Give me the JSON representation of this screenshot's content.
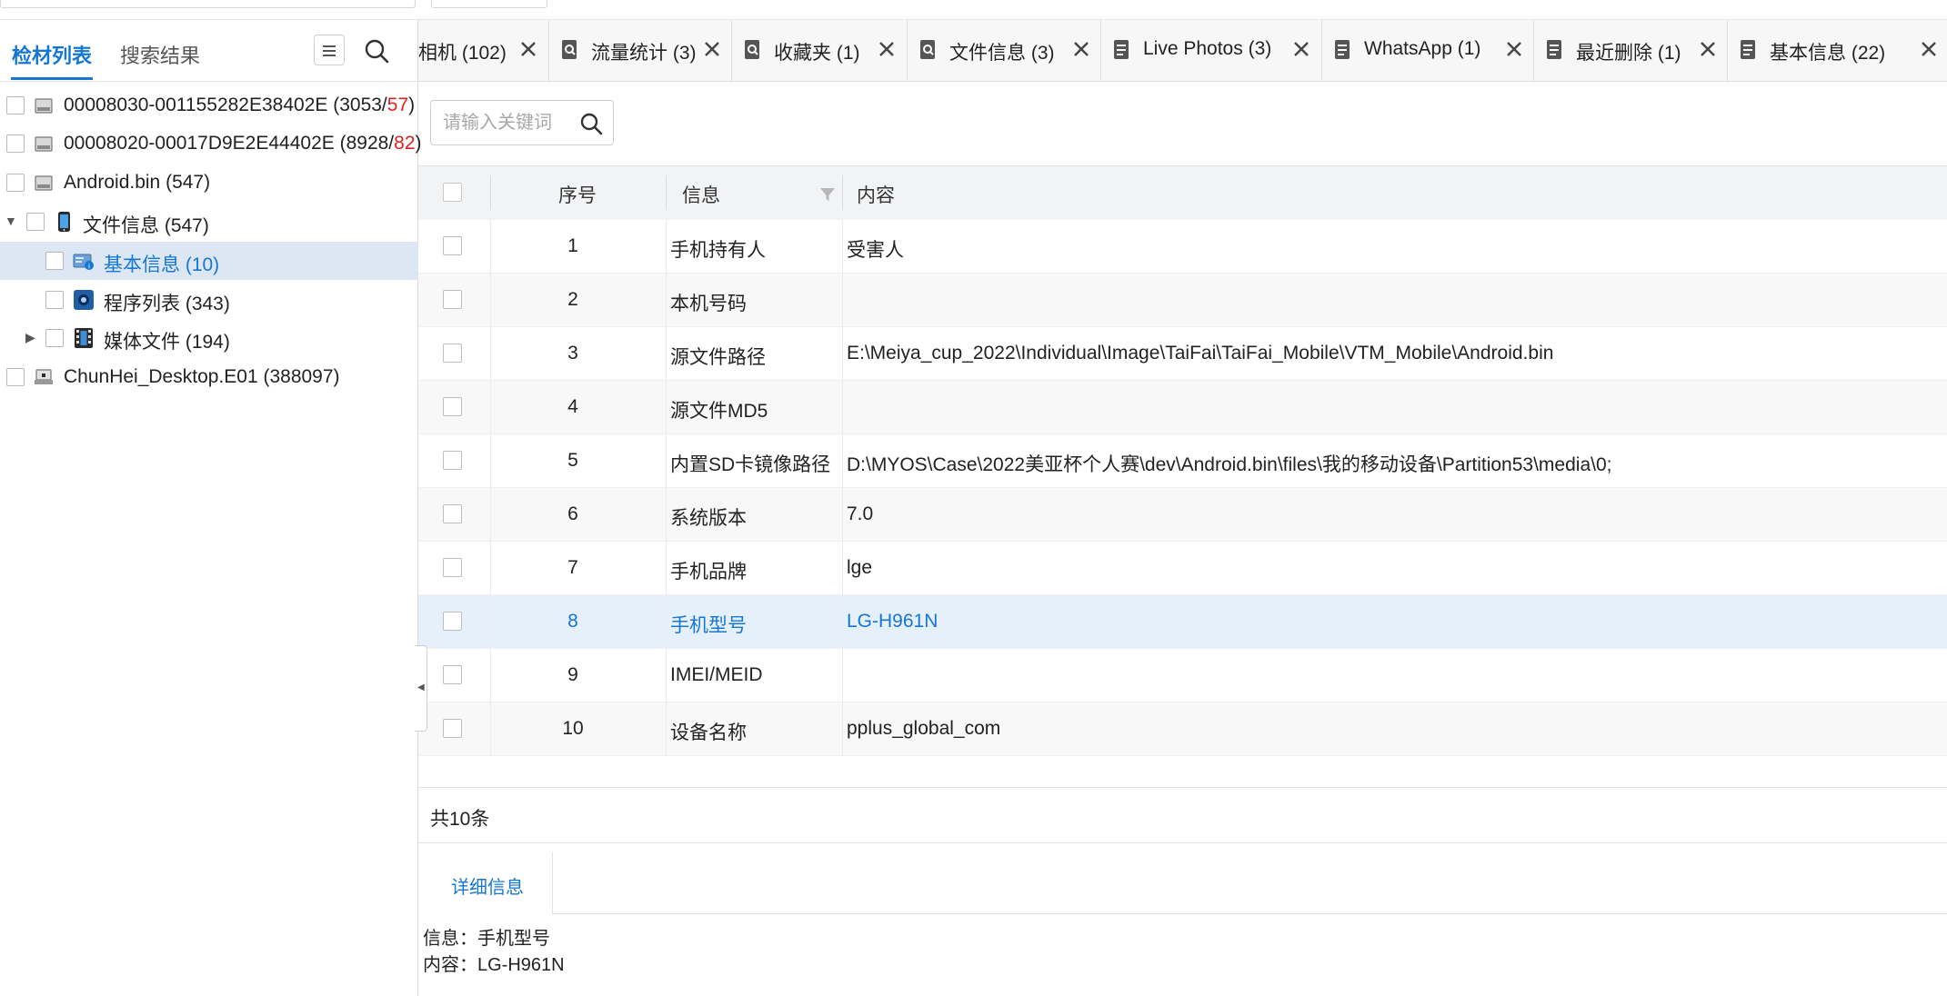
{
  "left_panel": {
    "tabs": [
      {
        "label": "检材列表",
        "active": true
      },
      {
        "label": "搜索结果",
        "active": false
      }
    ],
    "tree": [
      {
        "label": "00008030-001155282E38402E",
        "count_open": " (3053/",
        "count_red": "57",
        "count_close": ")",
        "icon": "disk-icon",
        "level": 0
      },
      {
        "label": "00008020-00017D9E2E44402E",
        "count_open": " (8928/",
        "count_red": "82",
        "count_close": ")",
        "icon": "disk-icon",
        "level": 0
      },
      {
        "label": "Android.bin (547)",
        "icon": "disk-icon",
        "level": 0
      },
      {
        "label": "文件信息 (547)",
        "icon": "phone-icon",
        "level": 0,
        "expanded": true
      },
      {
        "label": "基本信息 (10)",
        "icon": "info-card-icon",
        "level": 1,
        "selected": true
      },
      {
        "label": "程序列表 (343)",
        "icon": "app-list-icon",
        "level": 1
      },
      {
        "label": "媒体文件 (194)",
        "icon": "film-icon",
        "level": 1,
        "collapsed": true
      },
      {
        "label": "ChunHei_Desktop.E01 (388097)",
        "icon": "desktop-image-icon",
        "level": 0
      }
    ]
  },
  "tabs": [
    {
      "label": "相机 (102)",
      "icon": "none"
    },
    {
      "label": "流量统计 (3)",
      "icon": "search-doc-icon"
    },
    {
      "label": "收藏夹 (1)",
      "icon": "search-doc-icon"
    },
    {
      "label": "文件信息 (3)",
      "icon": "search-doc-icon"
    },
    {
      "label": "Live Photos (3)",
      "icon": "doc-icon"
    },
    {
      "label": "WhatsApp (1)",
      "icon": "doc-icon"
    },
    {
      "label": "最近删除 (1)",
      "icon": "doc-icon"
    },
    {
      "label": "基本信息 (22)",
      "icon": "doc-icon"
    }
  ],
  "search": {
    "placeholder": "请输入关键词",
    "value": ""
  },
  "grid": {
    "columns": [
      "序号",
      "信息",
      "内容"
    ],
    "rows": [
      {
        "no": "1",
        "info": "手机持有人",
        "content": "受害人"
      },
      {
        "no": "2",
        "info": "本机号码",
        "content": ""
      },
      {
        "no": "3",
        "info": "源文件路径",
        "content": "E:\\Meiya_cup_2022\\Individual\\Image\\TaiFai\\TaiFai_Mobile\\VTM_Mobile\\Android.bin"
      },
      {
        "no": "4",
        "info": "源文件MD5",
        "content": ""
      },
      {
        "no": "5",
        "info": "内置SD卡镜像路径",
        "content": "D:\\MYOS\\Case\\2022美亚杯个人赛\\dev\\Android.bin\\files\\我的移动设备\\Partition53\\media\\0;"
      },
      {
        "no": "6",
        "info": "系统版本",
        "content": "7.0"
      },
      {
        "no": "7",
        "info": "手机品牌",
        "content": "lge"
      },
      {
        "no": "8",
        "info": "手机型号",
        "content": "LG-H961N",
        "highlighted": true
      },
      {
        "no": "9",
        "info": "IMEI/MEID",
        "content": ""
      },
      {
        "no": "10",
        "info": "设备名称",
        "content": "pplus_global_com"
      }
    ]
  },
  "footer": {
    "total": "共10条"
  },
  "detail": {
    "tab_label": "详细信息",
    "info_line": "信息：手机型号",
    "content_line": "内容：LG-H961N"
  },
  "colors": {
    "accent": "#1677d2",
    "selected_row": "#e6f0fb",
    "tree_selected": "#dce7f3",
    "red_count": "#e02020"
  }
}
